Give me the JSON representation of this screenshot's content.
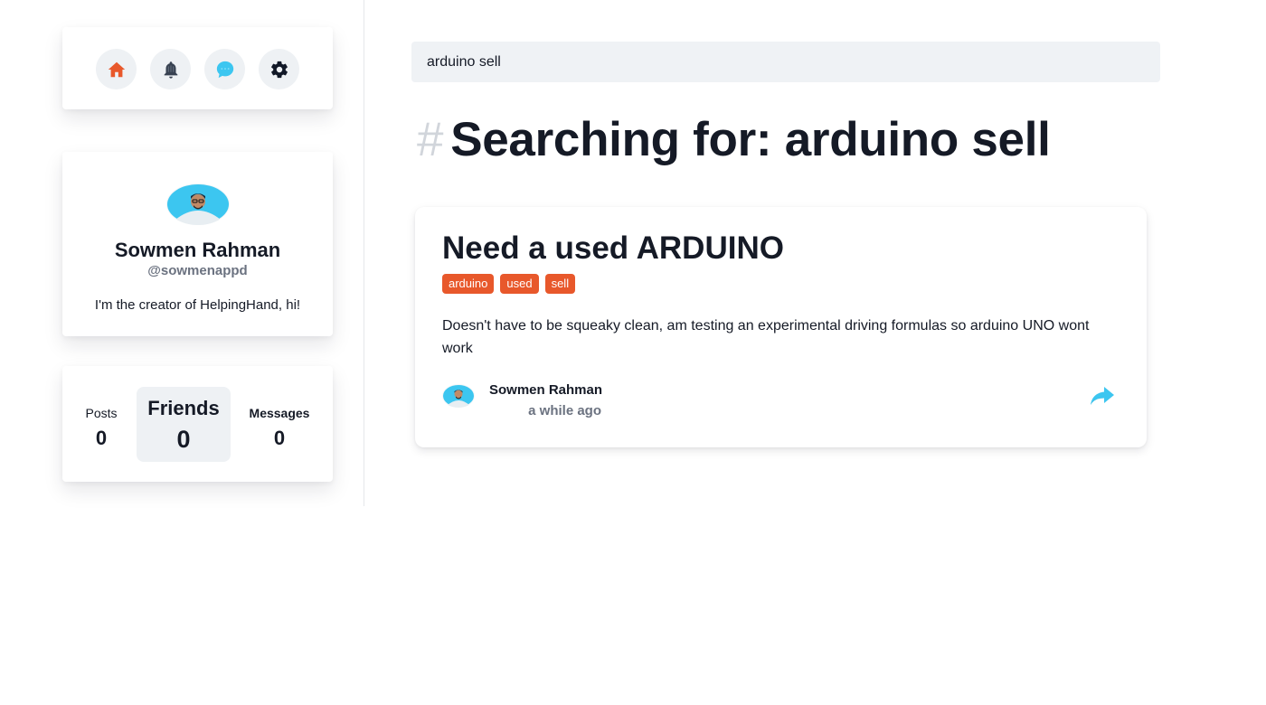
{
  "nav": {
    "items": [
      {
        "name": "home",
        "icon": "home-icon",
        "color": "#e8582b"
      },
      {
        "name": "notifications",
        "icon": "bell-icon",
        "color": "#374151"
      },
      {
        "name": "messages",
        "icon": "chat-bubble-icon",
        "color": "#3cc6f0"
      },
      {
        "name": "settings",
        "icon": "gear-icon",
        "color": "#111827"
      }
    ]
  },
  "profile": {
    "name": "Sowmen Rahman",
    "handle": "@sowmenappd",
    "bio": "I'm the creator of HelpingHand, hi!"
  },
  "stats": {
    "posts_label": "Posts",
    "posts_value": "0",
    "friends_label": "Friends",
    "friends_value": "0",
    "messages_label": "Messages",
    "messages_value": "0"
  },
  "search": {
    "value": "arduino sell"
  },
  "results": {
    "hash": "#",
    "heading": "Searching for: arduino sell"
  },
  "post": {
    "title": "Need a used ARDUINO",
    "tags": [
      "arduino",
      "used",
      "sell"
    ],
    "body": "Doesn't have to be squeaky clean, am testing an experimental driving formulas so arduino UNO wont work",
    "author": "Sowmen Rahman",
    "time": "a while ago",
    "share_icon": "share-arrow-icon"
  },
  "colors": {
    "accent": "#e8582b",
    "avatar_bg": "#3cc6f0",
    "text": "#151a26",
    "muted": "#6b7280"
  }
}
